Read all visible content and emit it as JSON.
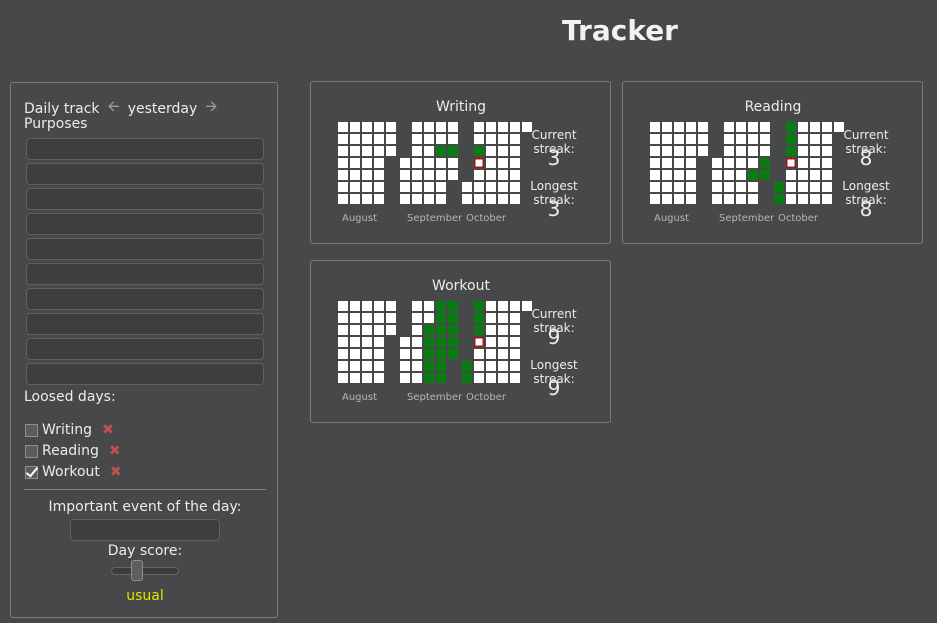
{
  "header": {
    "title": "Tracker"
  },
  "sidebar": {
    "daily_track_label": "Daily track",
    "day_label": "yesterday",
    "purposes_label": "Purposes",
    "purpose_inputs": [
      "",
      "",
      "",
      "",
      "",
      "",
      "",
      "",
      "",
      ""
    ],
    "loosed_days_label": "Loosed days:",
    "loosed_days": [
      {
        "label": "Writing",
        "checked": false
      },
      {
        "label": "Reading",
        "checked": false
      },
      {
        "label": "Workout",
        "checked": true
      }
    ],
    "event_label": "Important event of the day:",
    "event_value": "",
    "score_label": "Day score:",
    "score_value": "usual",
    "score_slider_fraction": 0.38,
    "score_color": "#e5e500",
    "icons": {
      "prev": "arrow-left-icon",
      "next": "arrow-right-icon",
      "remove": "close-icon"
    }
  },
  "colors": {
    "background": "#464849",
    "done": "#0a7a12",
    "empty": "#ffffff",
    "today_outline": "#b01010"
  },
  "trackers": [
    {
      "name": "Writing",
      "months": [
        "August",
        "September",
        "October"
      ],
      "current_streak_label": "Current streak:",
      "current_streak": "3",
      "longest_streak_label": "Longest streak:",
      "longest_streak": "3",
      "done_dates": [
        "2016-09-21",
        "2016-09-28",
        "2016-10-05"
      ],
      "today": "2016-10-06"
    },
    {
      "name": "Reading",
      "months": [
        "August",
        "September",
        "October"
      ],
      "current_streak_label": "Current streak:",
      "current_streak": "8",
      "longest_streak_label": "Longest streak:",
      "longest_streak": "8",
      "done_dates": [
        "2016-09-23",
        "2016-09-29",
        "2016-09-30",
        "2016-10-01",
        "2016-10-02",
        "2016-10-03",
        "2016-10-04",
        "2016-10-05"
      ],
      "today": "2016-10-06"
    },
    {
      "name": "Workout",
      "months": [
        "August",
        "September",
        "October"
      ],
      "current_streak_label": "Current streak:",
      "current_streak": "9",
      "longest_streak_label": "Longest streak:",
      "longest_streak": "9",
      "done_dates": [
        "2016-09-14",
        "2016-09-15",
        "2016-09-16",
        "2016-09-17",
        "2016-09-18",
        "2016-09-19",
        "2016-09-20",
        "2016-09-21",
        "2016-09-22",
        "2016-09-23",
        "2016-09-24",
        "2016-09-25",
        "2016-09-26",
        "2016-09-27",
        "2016-09-28",
        "2016-09-29",
        "2016-09-30",
        "2016-10-01",
        "2016-10-02",
        "2016-10-03",
        "2016-10-04",
        "2016-10-05"
      ],
      "today": "2016-10-06"
    }
  ]
}
